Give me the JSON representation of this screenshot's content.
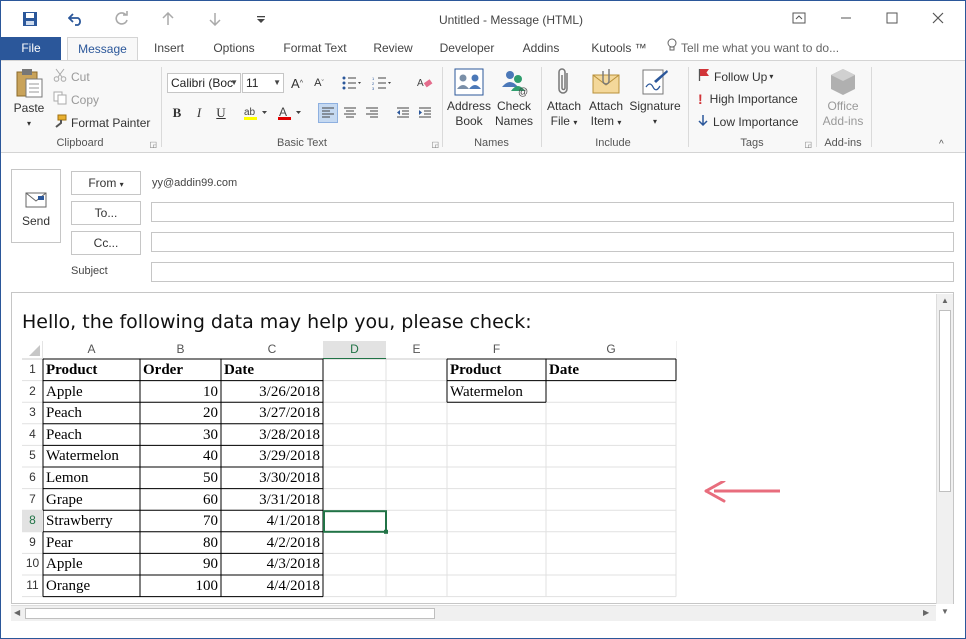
{
  "window": {
    "title": "Untitled - Message (HTML)"
  },
  "quick_access": [
    "save-icon",
    "undo-icon",
    "redo-icon",
    "up-arrow-icon",
    "down-arrow-icon",
    "customize-icon"
  ],
  "tabs": [
    {
      "label": "File"
    },
    {
      "label": "Message"
    },
    {
      "label": "Insert"
    },
    {
      "label": "Options"
    },
    {
      "label": "Format Text"
    },
    {
      "label": "Review"
    },
    {
      "label": "Developer"
    },
    {
      "label": "Addins"
    },
    {
      "label": "Kutools ™"
    }
  ],
  "tell_me": "Tell me what you want to do...",
  "ribbon": {
    "clipboard": {
      "label": "Clipboard",
      "paste": "Paste",
      "cut": "Cut",
      "copy": "Copy",
      "format_painter": "Format Painter"
    },
    "basic_text": {
      "label": "Basic Text",
      "font": "Calibri (Boc",
      "size": "11",
      "bold": "B",
      "italic": "I",
      "underline": "U"
    },
    "names": {
      "label": "Names",
      "address_book_1": "Address",
      "address_book_2": "Book",
      "check_names_1": "Check",
      "check_names_2": "Names"
    },
    "include": {
      "label": "Include",
      "attach_file_1": "Attach",
      "attach_file_2": "File",
      "attach_item_1": "Attach",
      "attach_item_2": "Item",
      "signature": "Signature"
    },
    "tags": {
      "label": "Tags",
      "follow_up": "Follow Up",
      "high_importance": "High Importance",
      "low_importance": "Low Importance"
    },
    "addins": {
      "label": "Add-ins",
      "office_1": "Office",
      "office_2": "Add-ins"
    }
  },
  "compose": {
    "send": "Send",
    "from_btn": "From",
    "from_value": "yy@addin99.com",
    "to_btn": "To...",
    "cc_btn": "Cc...",
    "subject_label": "Subject"
  },
  "body": {
    "greeting": "Hello, the following data may help you, please check:"
  },
  "sheet": {
    "columns": [
      "A",
      "B",
      "C",
      "D",
      "E",
      "F",
      "G"
    ],
    "rows": [
      "1",
      "2",
      "3",
      "4",
      "5",
      "6",
      "7",
      "8",
      "9",
      "10",
      "11"
    ],
    "header": {
      "product": "Product",
      "order": "Order",
      "date": "Date"
    },
    "data": [
      {
        "product": "Apple",
        "order": "10",
        "date": "3/26/2018"
      },
      {
        "product": "Peach",
        "order": "20",
        "date": "3/27/2018"
      },
      {
        "product": "Peach",
        "order": "30",
        "date": "3/28/2018"
      },
      {
        "product": "Watermelon",
        "order": "40",
        "date": "3/29/2018"
      },
      {
        "product": "Lemon",
        "order": "50",
        "date": "3/30/2018"
      },
      {
        "product": "Grape",
        "order": "60",
        "date": "3/31/2018"
      },
      {
        "product": "Strawberry",
        "order": "70",
        "date": "4/1/2018"
      },
      {
        "product": "Pear",
        "order": "80",
        "date": "4/2/2018"
      },
      {
        "product": "Apple",
        "order": "90",
        "date": "4/3/2018"
      },
      {
        "product": "Orange",
        "order": "100",
        "date": "4/4/2018"
      }
    ],
    "lookup": {
      "product_header": "Product",
      "date_header": "Date",
      "product_value": "Watermelon"
    },
    "selected_cell": "D8"
  },
  "colors": {
    "accent": "#2b579a",
    "arrow": "#e86d7d",
    "selection": "#217346"
  }
}
